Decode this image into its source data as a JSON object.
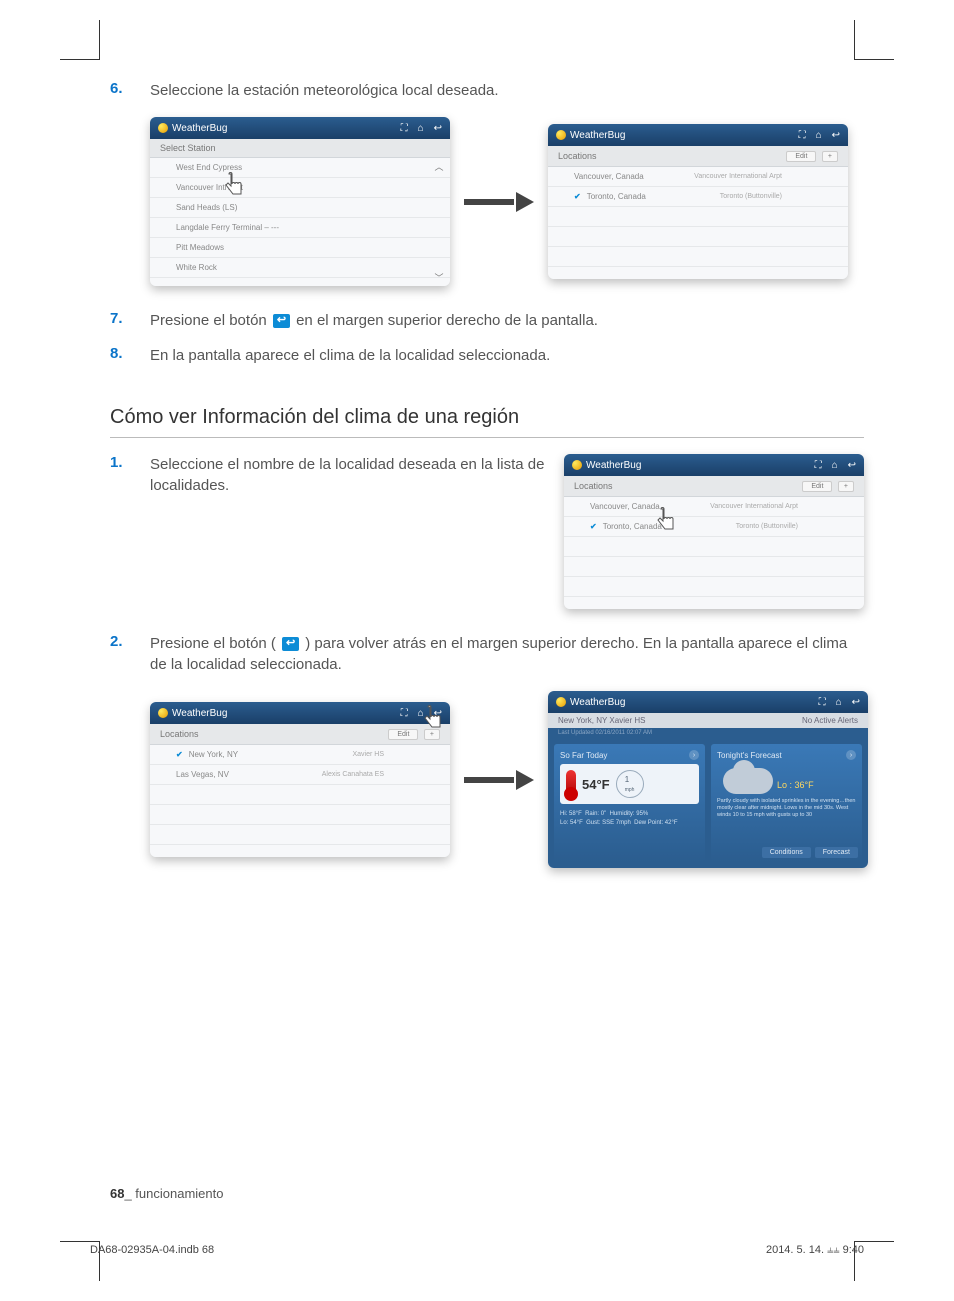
{
  "steps_a": [
    {
      "num": "6.",
      "text": "Seleccione la estación meteorológica local deseada."
    },
    {
      "num": "7.",
      "text_before": "Presione el botón ",
      "text_after": " en el margen superior derecho de la pantalla."
    },
    {
      "num": "8.",
      "text": "En la pantalla aparece el clima de la localidad seleccionada."
    }
  ],
  "section_heading": "Cómo ver Información del clima de una región",
  "steps_b": [
    {
      "num": "1.",
      "text": "Seleccione el nombre de la localidad deseada en la lista de localidades."
    },
    {
      "num": "2.",
      "text_before": "Presione el botón ( ",
      "text_after": " ) para volver atrás en el margen superior derecho. En la pantalla aparece el clima de la localidad seleccionada."
    }
  ],
  "mock": {
    "app_name": "WeatherBug",
    "icons": {
      "expand": "⛶",
      "home": "⌂",
      "back": "↩"
    },
    "edit": "Edit",
    "plus": "+"
  },
  "s1": {
    "subtitle": "Select Station",
    "items": [
      "West End Cypress",
      "Vancouver Intl Arpt",
      "Sand Heads (LS)",
      "Langdale Ferry Terminal – ---",
      "Pitt Meadows",
      "White Rock"
    ]
  },
  "s2": {
    "subtitle": "Locations",
    "rows": [
      {
        "city": "Vancouver, Canada",
        "station": "Vancouver International Arpt",
        "checked": false
      },
      {
        "city": "Toronto, Canada",
        "station": "Toronto (Buttonville)",
        "checked": true
      }
    ]
  },
  "s3": {
    "subtitle": "Locations",
    "rows": [
      {
        "city": "Vancouver, Canada",
        "station": "Vancouver International Arpt",
        "checked": false
      },
      {
        "city": "Toronto, Canada",
        "station": "Toronto (Buttonville)",
        "checked": true
      }
    ]
  },
  "s4": {
    "subtitle": "Locations",
    "rows": [
      {
        "city": "New York, NY",
        "station": "Xavier HS",
        "checked": true
      },
      {
        "city": "Las Vegas, NV",
        "station": "Alexis Canahata ES",
        "checked": false
      }
    ]
  },
  "s5": {
    "location": "New York, NY Xavier HS",
    "alerts": "No Active Alerts",
    "updated": "Last Updated 02/16/2011 02:07 AM",
    "left_title": "So Far Today",
    "right_title": "Tonight's Forecast",
    "temp": "54°F",
    "wind_speed": "1",
    "wind_unit": "mph",
    "hi": "Hi: 58°F",
    "lo": "Lo: 54°F",
    "rain": "Rain: 0\"",
    "gust": "Gust: SSE 7mph",
    "humidity": "Humidity: 95%",
    "dew": "Dew Point: 42°F",
    "forecast_lo": "Lo : 36°F",
    "forecast_text": "Partly cloudy with isolated sprinkles in the evening…then mostly clear after midnight. Lows in the mid 30s. West winds 10 to 15 mph with gusts up to 30",
    "btn_conditions": "Conditions",
    "btn_forecast": "Forecast"
  },
  "footer": {
    "page": "68",
    "label": "_ funcionamiento"
  },
  "meta": {
    "file": "DA68-02935A-04.indb   68",
    "date": "2014. 5. 14.   ⫨⫨ 9:40"
  }
}
